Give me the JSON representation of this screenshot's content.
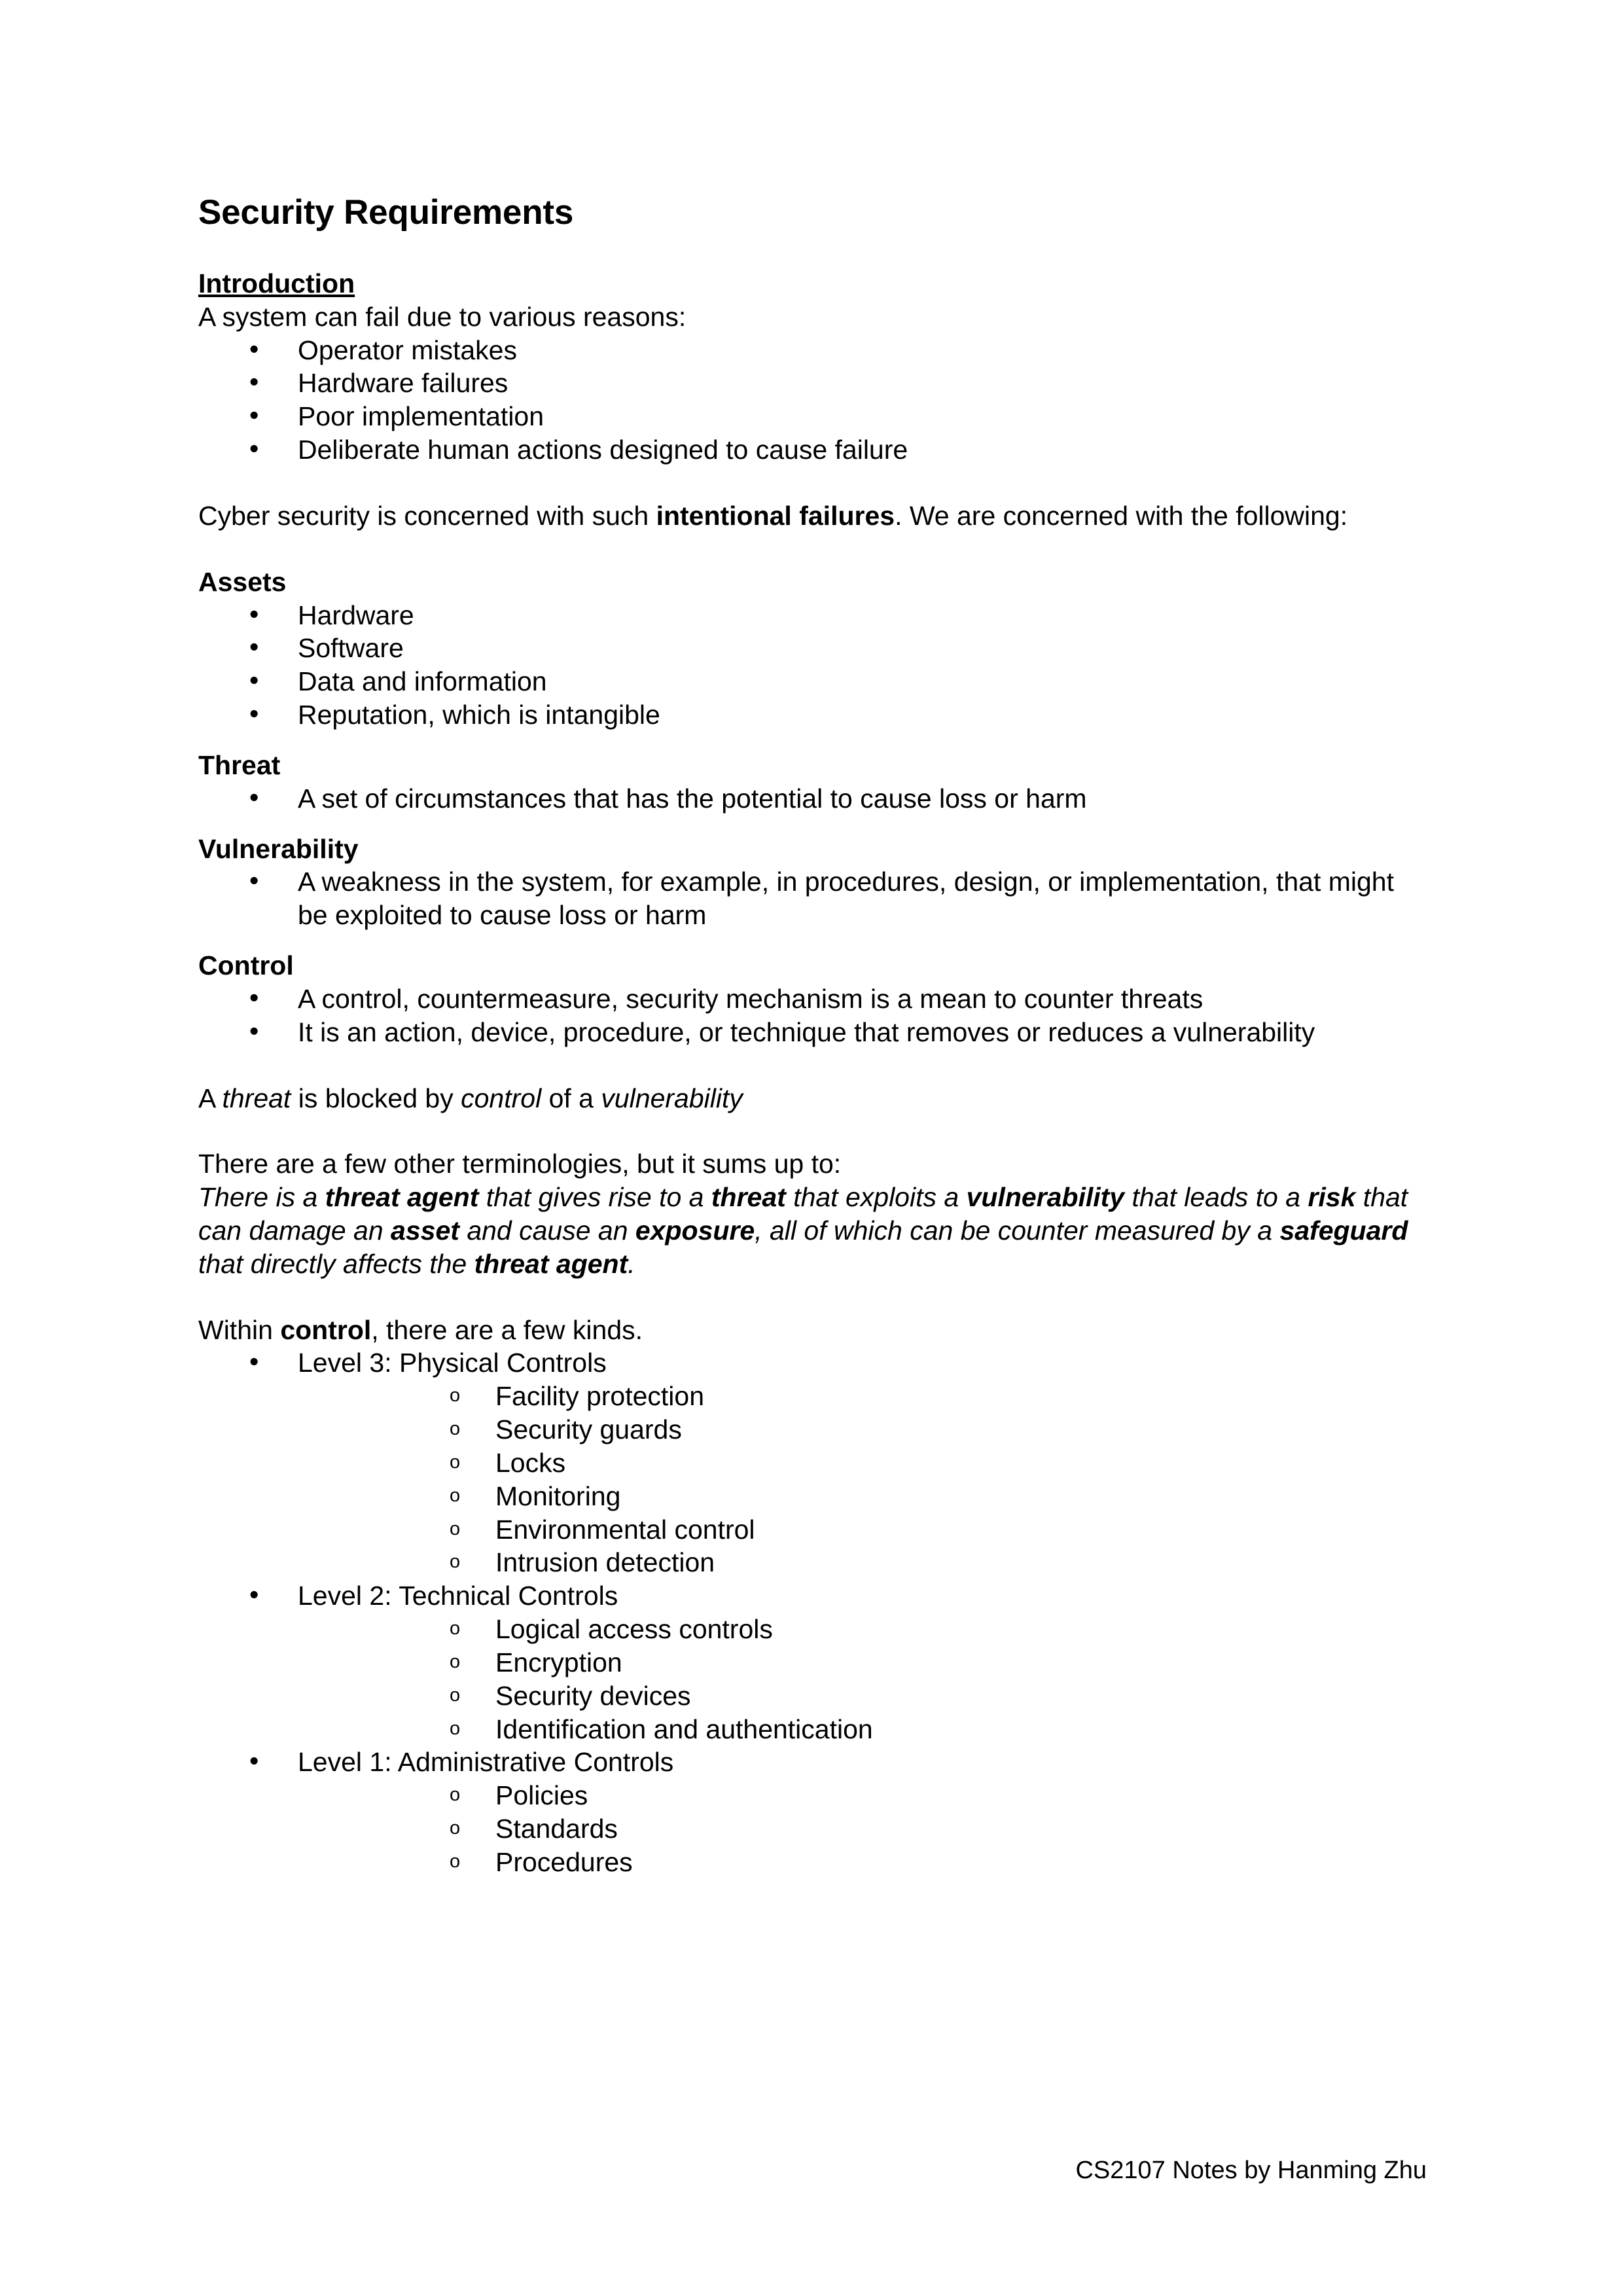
{
  "document": {
    "title": "Security Requirements",
    "footer": "CS2107 Notes by Hanming Zhu"
  },
  "sections": {
    "introduction": {
      "heading": "Introduction",
      "intro_line": "A system can fail due to various reasons:",
      "bullets": [
        "Operator mistakes",
        "Hardware failures",
        "Poor implementation",
        "Deliberate human actions designed to cause failure"
      ],
      "cyber_para": {
        "part1": "Cyber security is concerned with such ",
        "bold1": "intentional failures",
        "part2": ". We are concerned with the following:"
      }
    },
    "assets": {
      "heading": "Assets",
      "bullets": [
        "Hardware",
        "Software",
        "Data and information",
        "Reputation, which is intangible"
      ]
    },
    "threat": {
      "heading": "Threat",
      "bullets": [
        "A set of circumstances that has the potential to cause loss or harm"
      ]
    },
    "vulnerability": {
      "heading": "Vulnerability",
      "bullets": [
        "A weakness in the system, for example, in procedures, design, or implementation, that might be exploited to cause loss or harm"
      ]
    },
    "control": {
      "heading": "Control",
      "bullets": [
        "A control, countermeasure, security mechanism is a mean to counter threats",
        "It is an action, device, procedure, or technique that removes or reduces a vulnerability"
      ]
    },
    "threat_blocked": {
      "part1": "A ",
      "italic1": "threat",
      "part2": " is blocked by ",
      "italic2": "control",
      "part3": " of a ",
      "italic3": "vulnerability"
    },
    "terminologies": {
      "lead_in": "There are a few other terminologies, but it sums up to:",
      "summary": {
        "s1": "There is a ",
        "b1": "threat agent",
        "s2": " that gives rise to a ",
        "b2": "threat",
        "s3": " that exploits a ",
        "b3": "vulnerability",
        "s4": " that leads to a ",
        "b4": "risk",
        "s5": " that can damage an ",
        "b5": "asset",
        "s6": " and cause an ",
        "b6": "exposure",
        "s7": ", all of which can be counter measured by a ",
        "b7": "safeguard",
        "s8": " that directly affects the ",
        "b8": "threat agent",
        "s9": "."
      }
    },
    "within_control": {
      "lead_in": {
        "part1": "Within ",
        "bold1": "control",
        "part2": ", there are a few kinds."
      },
      "levels": [
        {
          "label": "Level 3: Physical Controls",
          "items": [
            "Facility protection",
            "Security guards",
            "Locks",
            "Monitoring",
            "Environmental control",
            "Intrusion detection"
          ]
        },
        {
          "label": "Level 2: Technical Controls",
          "items": [
            "Logical access controls",
            "Encryption",
            "Security devices",
            "Identification and authentication"
          ]
        },
        {
          "label": "Level 1: Administrative Controls",
          "items": [
            "Policies",
            "Standards",
            "Procedures"
          ]
        }
      ]
    }
  }
}
